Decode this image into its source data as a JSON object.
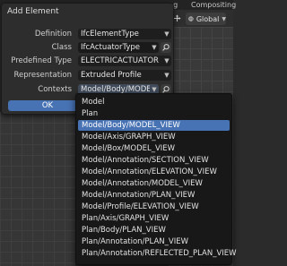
{
  "app": {
    "header_tabs": [
      "ng",
      "Compositing"
    ],
    "global_orientation": "Global"
  },
  "dialog": {
    "title": "Add Element",
    "rows": [
      {
        "label": "Definition",
        "value": "IfcElementType"
      },
      {
        "label": "Class",
        "value": "IfcActuatorType"
      },
      {
        "label": "Predefined Type",
        "value": "ELECTRICACTUATOR"
      },
      {
        "label": "Representation",
        "value": "Extruded Profile"
      },
      {
        "label": "Contexts",
        "value": "Model/Body/MODEL_VI..."
      }
    ],
    "ok_label": "OK"
  },
  "contexts_menu": {
    "selected_index": 2,
    "options": [
      "Model",
      "Plan",
      "Model/Body/MODEL_VIEW",
      "Model/Axis/GRAPH_VIEW",
      "Model/Box/MODEL_VIEW",
      "Model/Annotation/SECTION_VIEW",
      "Model/Annotation/ELEVATION_VIEW",
      "Model/Annotation/MODEL_VIEW",
      "Model/Annotation/PLAN_VIEW",
      "Model/Profile/ELEVATION_VIEW",
      "Plan/Axis/GRAPH_VIEW",
      "Plan/Body/PLAN_VIEW",
      "Plan/Annotation/PLAN_VIEW",
      "Plan/Annotation/REFLECTED_PLAN_VIEW"
    ]
  },
  "colors": {
    "accent": "#4772b3",
    "dialog_bg": "#2d2d2d",
    "menu_bg": "#181818"
  }
}
